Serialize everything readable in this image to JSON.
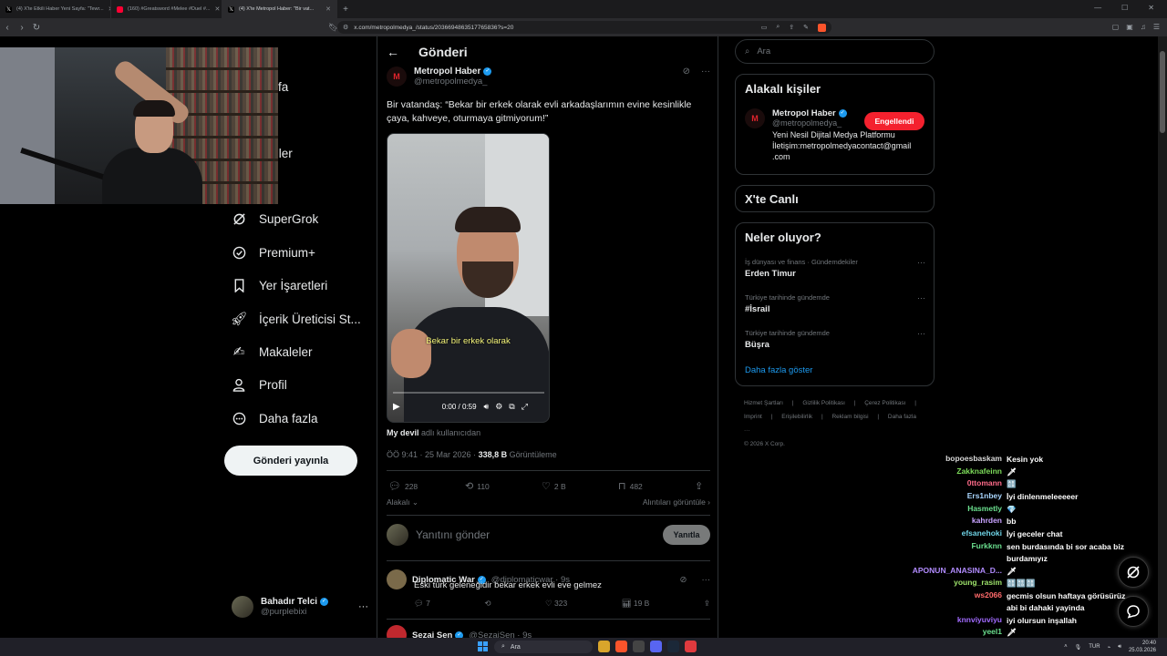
{
  "browser": {
    "tabs": [
      {
        "title": "(4) X'te Etkili Haber Yeni Sayfa: \"Tewr...",
        "icon": "x-icon"
      },
      {
        "title": "(160) #Greatsword #Melee #Duel #...",
        "icon": "youtube-icon"
      },
      {
        "title": "(4) X'te Metropol Haber: \"Bir vat...",
        "icon": "x-icon",
        "active": true
      }
    ],
    "url": "x.com/metropolmedya_/status/2036694863517765836?s=20"
  },
  "sidebar": {
    "items": [
      {
        "label": "sayfa",
        "icon": "home-icon"
      },
      {
        "label": "fet",
        "icon": "explore-icon"
      },
      {
        "label": "irimler",
        "icon": "notifications-icon"
      },
      {
        "label": "bet",
        "icon": "messages-icon"
      },
      {
        "label": "SuperGrok",
        "icon": "grok-icon"
      },
      {
        "label": "Premium+",
        "icon": "premium-icon"
      },
      {
        "label": "Yer İşaretleri",
        "icon": "bookmark-icon"
      },
      {
        "label": "İçerik Üreticisi St...",
        "icon": "rocket-icon"
      },
      {
        "label": "Makaleler",
        "icon": "article-icon"
      },
      {
        "label": "Profil",
        "icon": "profile-icon"
      },
      {
        "label": "Daha fazla",
        "icon": "more-icon"
      }
    ],
    "post_button": "Gönderi yayınla",
    "account": {
      "name": "Bahadır Telci",
      "handle": "@purplebixi"
    }
  },
  "main": {
    "title": "Gönderi",
    "tweet": {
      "author": "Metropol Haber",
      "handle": "@metropolmedya_",
      "logo_letter": "M",
      "text": "Bir vatandaş: “Bekar bir erkek olarak evli arkadaşlarımın evine kesinlikle çaya, kahveye, oturmaya gitmiyorum!”",
      "video": {
        "caption": "Bekar bir erkek olarak",
        "time": "0:00 / 0:59",
        "progress": 0
      },
      "attribution_user": "My devil",
      "attribution_suffix": "adlı kullanıcıdan",
      "timestamp": "ÖÖ 9:41 · 25 Mar 2026 ·",
      "views_count": "338,8 B",
      "views_label": "Görüntüleme",
      "stats": {
        "replies": "228",
        "reposts": "110",
        "likes": "2 B",
        "bookmarks": "482"
      },
      "related_label": "Alakalı",
      "quotes_label": "Alıntıları görüntüle"
    },
    "reply_placeholder": "Yanıtını gönder",
    "reply_button": "Yanıtla",
    "replies": [
      {
        "name": "Diplomatic War",
        "handle": "@diplomaticwar · 9s",
        "text": "Eski türk geleneğidir bekar erkek evli eve gelmez",
        "stats": {
          "replies": "7",
          "reposts": "",
          "likes": "323",
          "views": "19 B"
        }
      },
      {
        "name": "Sezai Sen",
        "handle": "@SezaiSen · 9s"
      }
    ]
  },
  "right": {
    "search_placeholder": "Ara",
    "related_people": {
      "title": "Alakalı kişiler",
      "name": "Metropol Haber",
      "handle": "@metropolmedya_",
      "bio_line1": "Yeni Nesil Dijital Medya Platformu",
      "bio_line2": "İletişim:metropolmedyacontact@gmail",
      "bio_line3": ".com",
      "button": "Engellendi"
    },
    "live_title": "X'te Canlı",
    "trends_title": "Neler oluyor?",
    "trends": [
      {
        "meta": "İş dünyası ve finans · Gündemdekiler",
        "name": "Erden Timur"
      },
      {
        "meta": "Türkiye tarihinde gündemde",
        "name": "#İsrail"
      },
      {
        "meta": "Türkiye tarihinde gündemde",
        "name": "Büşra"
      }
    ],
    "show_more": "Daha fazla göster",
    "footer_links": [
      "Hizmet Şartları",
      "|",
      "Gizlilik Politikası",
      "|",
      "Çerez Politikası",
      "|",
      "Imprint",
      "|",
      "Erişilebilirlik",
      "|",
      "Reklam bilgisi",
      "|",
      "Daha fazla ···"
    ],
    "copyright": "© 2026 X Corp."
  },
  "chat": [
    {
      "user": "bopoesbaskam",
      "msg": "Kesin yok",
      "color": "#d9d9d9"
    },
    {
      "user": "Zakknafeinn",
      "msg": "🗡",
      "color": "#7ddc5a"
    },
    {
      "user": "0ttomann",
      "msg": "🔠",
      "color": "#ff6b8a"
    },
    {
      "user": "Ers1nbey",
      "msg": "İyi dinlenmeleeeeer",
      "color": "#a9d6ff"
    },
    {
      "user": "Hasmetly",
      "msg": "💎",
      "color": "#6be08f"
    },
    {
      "user": "kahrden",
      "msg": "bb",
      "color": "#c8a2ff"
    },
    {
      "user": "efsanehoki",
      "msg": "İyi geceler chat",
      "color": "#6fd3e6"
    },
    {
      "user": "Furkknn",
      "msg": "sen burdasında bi sor acaba biz burdamıyız",
      "color": "#6be08f"
    },
    {
      "user": "APONUN_ANASINA_D...",
      "msg": "🗡",
      "color": "#b28cff"
    },
    {
      "user": "young_rasim",
      "msg": "🔠🔠🔠",
      "color": "#9ee36b"
    },
    {
      "user": "ws2066",
      "msg": "gecmis olsun haftaya görüsürüz abi bi dahaki yayinda",
      "color": "#ff6b6b"
    },
    {
      "user": "knnviyuviyu",
      "msg": "iyi olursun inşallah",
      "color": "#a26bff"
    },
    {
      "user": "yeel1",
      "msg": "🗡",
      "color": "#6be08f"
    }
  ],
  "taskbar": {
    "search": "Ara",
    "lang": "TUR",
    "time": "20:40",
    "date": "25.03.2026"
  }
}
